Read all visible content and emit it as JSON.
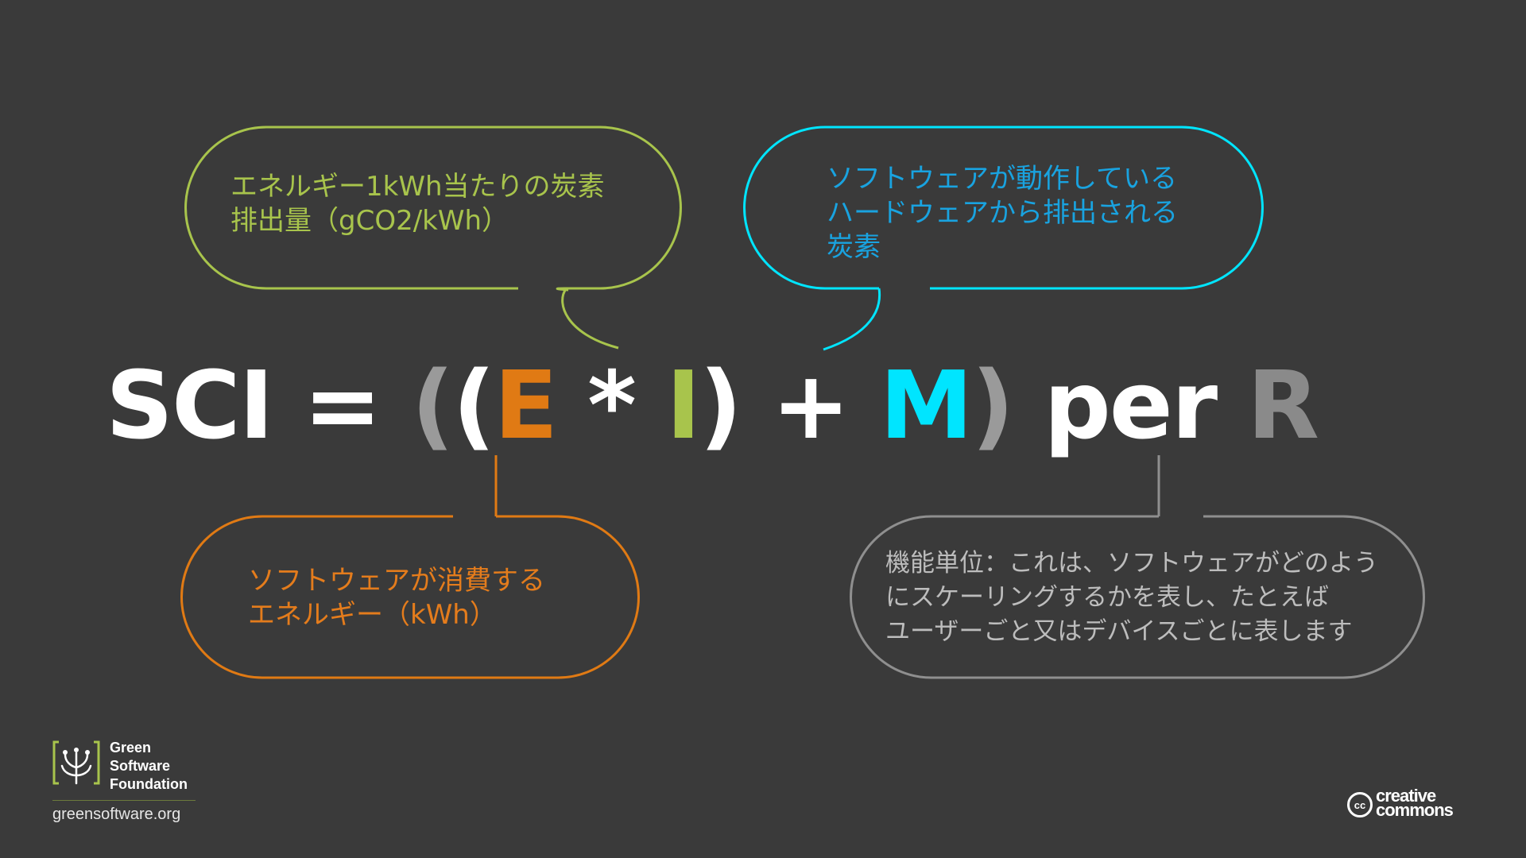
{
  "formula": {
    "sci": "SCI",
    "equals": "=",
    "open_outer": "(",
    "open_inner": "(",
    "e": "E",
    "times": "*",
    "i": "I",
    "close_inner": ")",
    "plus": "+",
    "m": "M",
    "close_outer": ")",
    "per": "per",
    "r": "R"
  },
  "callouts": {
    "i": {
      "lines": [
        "エネルギー1kWh当たりの炭素",
        "排出量（gCO2/kWh）"
      ],
      "color": "#a8c44c"
    },
    "m": {
      "lines": [
        "ソフトウェアが動作している",
        "ハードウェアから排出される",
        "炭素"
      ],
      "color": "#19a3e0"
    },
    "e": {
      "lines": [
        "ソフトウェアが消費する",
        "エネルギー（kWh）"
      ],
      "color": "#e47c1c"
    },
    "r": {
      "lines": [
        "機能単位：これは、ソフトウェアがどのよう",
        "にスケーリングするかを表し、たとえば",
        "ユーザーごと又はデバイスごとに表します"
      ],
      "color": "#bdbdbd"
    }
  },
  "footer": {
    "org_name": "Green Software Foundation",
    "website": "greensoftware.org",
    "license_line1": "creative",
    "license_line2": "commons"
  },
  "colors": {
    "background": "#3a3a3a",
    "orange": "#e07a14",
    "green": "#a8c44c",
    "cyan": "#00e5ff",
    "gray": "#9a9a9a"
  },
  "icons": [
    "tree-logo-icon",
    "creative-commons-icon"
  ]
}
